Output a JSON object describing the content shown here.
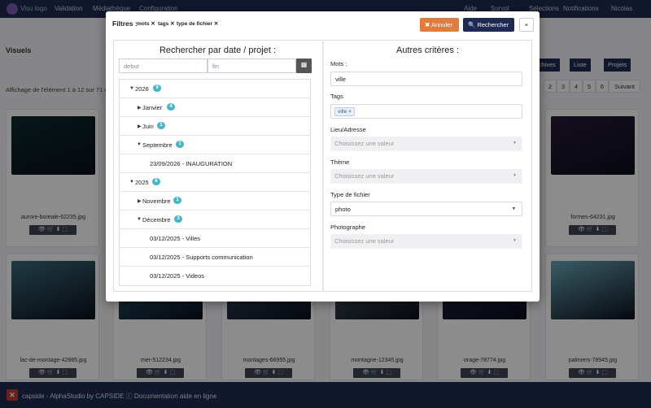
{
  "navbar": {
    "brand": "Visu logo",
    "menus": [
      "Validation",
      "Médiathèque",
      "Configuration"
    ],
    "right": [
      "Aide",
      "Survol",
      "Sélections",
      "Notifications",
      "Nicolas"
    ]
  },
  "page": {
    "title": "Visuels",
    "showing": "Affichage de l'élément 1 à 12 sur 71 é",
    "toolbar": {
      "archives": "archives",
      "liste": "Liste",
      "projets": "Projets"
    },
    "pager": [
      "2",
      "3",
      "4",
      "5",
      "6",
      "Suivant"
    ],
    "cards": [
      {
        "name": "aurore-boreale-62235.jpg",
        "color": "#0d2b2f"
      },
      {
        "name": "formes-64231.jpg",
        "color": "#2a1a3a"
      },
      {
        "name": "lac-de-montage-42885.jpg",
        "color": "#3b6b7a"
      },
      {
        "name": "mer-512234.jpg",
        "color": "#2f6f86"
      },
      {
        "name": "montages-66955.jpg",
        "color": "#3d5c7a"
      },
      {
        "name": "montagne-12345.jpg",
        "color": "#5b6a78"
      },
      {
        "name": "orage-78774.jpg",
        "color": "#2a2a52"
      },
      {
        "name": "palmiers-78945.jpg",
        "color": "#6aa8b8"
      }
    ]
  },
  "modal": {
    "filters_label": "Filtres :",
    "filter_chips": [
      "mots",
      "tags",
      "type de fichier"
    ],
    "cancel": "Annuler",
    "search": "Rechercher",
    "close": "×",
    "left": {
      "title": "Rechercher par date / projet :",
      "start_placeholder": "debut",
      "end_placeholder": "fin",
      "tree": [
        {
          "label": "2026",
          "badge": "9",
          "level": 0,
          "caret": "down"
        },
        {
          "label": "Janvier",
          "badge": "4",
          "level": 1,
          "caret": "right"
        },
        {
          "label": "Juin",
          "badge": "1",
          "level": 1,
          "caret": "right"
        },
        {
          "label": "Septembre",
          "badge": "1",
          "level": 1,
          "caret": "down"
        },
        {
          "label": "23/09/2026 - INAUGURATION",
          "badge": "",
          "level": 2,
          "caret": ""
        },
        {
          "label": "2025",
          "badge": "6",
          "level": 0,
          "caret": "down"
        },
        {
          "label": "Novembre",
          "badge": "1",
          "level": 1,
          "caret": "right"
        },
        {
          "label": "Décembre",
          "badge": "3",
          "level": 1,
          "caret": "down"
        },
        {
          "label": "03/12/2025 - Villes",
          "badge": "",
          "level": 2,
          "caret": ""
        },
        {
          "label": "03/12/2025 - Supports communication",
          "badge": "",
          "level": 2,
          "caret": ""
        },
        {
          "label": "03/12/2025 - Videos",
          "badge": "",
          "level": 2,
          "caret": ""
        }
      ]
    },
    "right": {
      "title": "Autres critères :",
      "mots_label": "Mots :",
      "mots_value": "ville",
      "tags_label": "Tags",
      "tag_value": "ville",
      "lieu_label": "Lieu/Adresse",
      "lieu_placeholder": "Choisissez une valeur",
      "theme_label": "Thème",
      "theme_placeholder": "Choisissez une valeur",
      "type_label": "Type de fichier",
      "type_value": "photo",
      "photographe_label": "Photographe",
      "photographe_placeholder": "Choisissez une valeur"
    }
  },
  "footer": {
    "text": "capside - AlphaStudio by CAPSIDE",
    "doc": "Documentation aide en ligne"
  },
  "colors": {
    "navy": "#1f2a52",
    "cancel": "#e07c3e",
    "badge": "#4ab3c6"
  }
}
